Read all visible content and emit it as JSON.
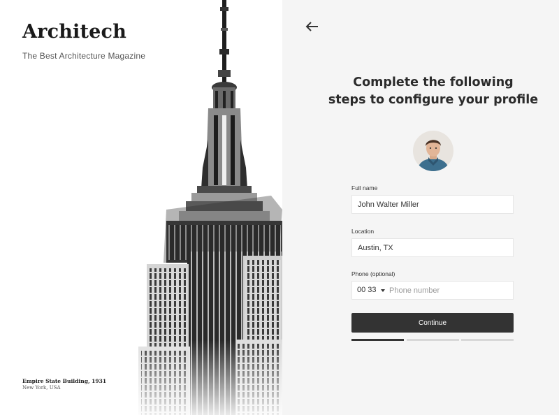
{
  "brand": {
    "title": "Architech",
    "tagline": "The Best Architecture Magazine"
  },
  "photo_caption": {
    "title": "Empire State Building, 1931",
    "location": "New York, USA"
  },
  "form": {
    "headline_line1": "Complete the following",
    "headline_line2": "steps to configure your profile",
    "full_name": {
      "label": "Full name",
      "value": "John Walter Miller"
    },
    "location": {
      "label": "Location",
      "value": "Austin, TX"
    },
    "phone": {
      "label": "Phone (optional)",
      "country_code": "00 33",
      "placeholder": "Phone number"
    },
    "continue_label": "Continue"
  },
  "progress": {
    "steps": 3,
    "current": 1
  },
  "icons": {
    "back": "arrow-left-icon",
    "avatar": "user-photo",
    "dropdown": "caret-down-icon"
  },
  "colors": {
    "right_panel_bg": "#f5f5f5",
    "button_bg": "#333333",
    "progress_active": "#333333",
    "progress_inactive": "#d8d8d8"
  }
}
